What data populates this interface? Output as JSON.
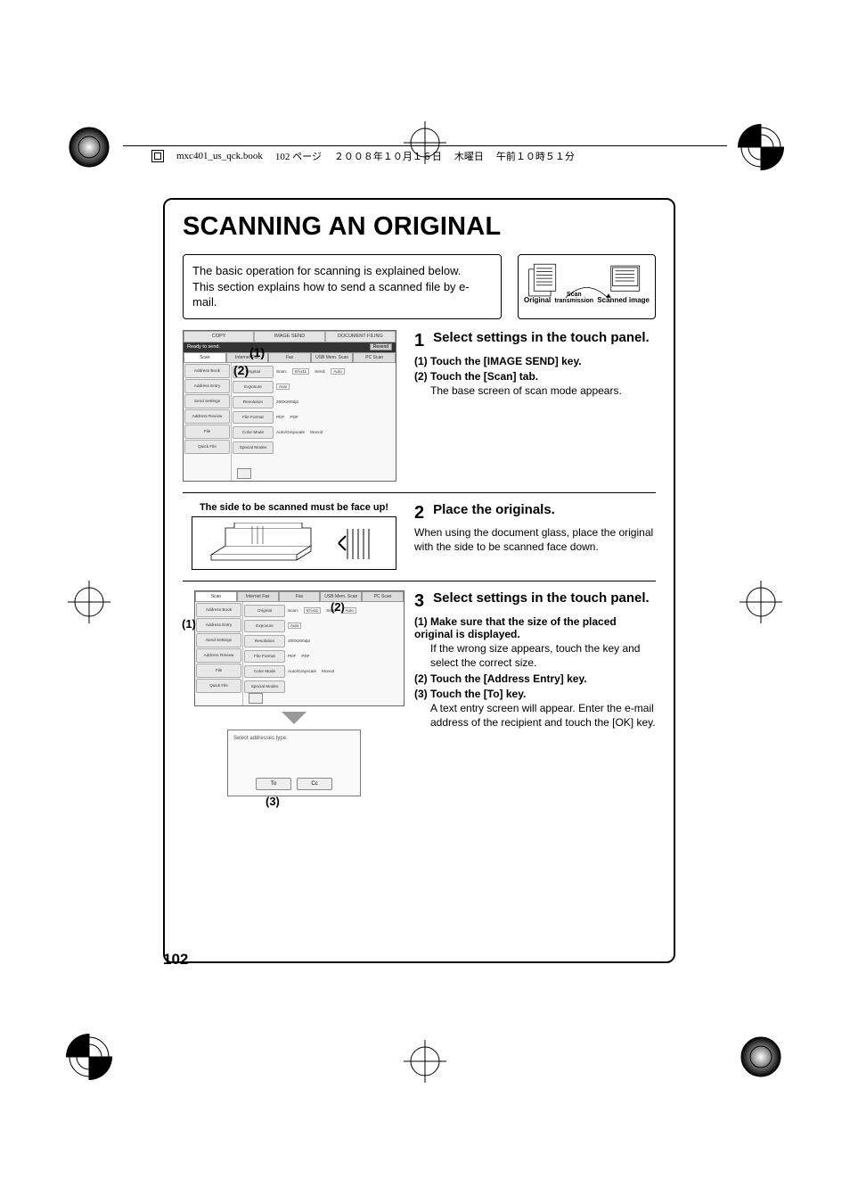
{
  "header_meta": {
    "filename": "mxc401_us_qck.book",
    "page_jp": "102 ページ",
    "date_jp": "２００８年１０月１６日",
    "weekday_jp": "木曜日",
    "time_jp": "午前１０時５１分"
  },
  "page_title": "SCANNING AN ORIGINAL",
  "intro": {
    "line1": "The basic operation for scanning is explained below.",
    "line2": "This section explains how to send a scanned file by e-mail."
  },
  "diagram_labels": {
    "left": "Original",
    "mid_top": "Scan",
    "mid_bot": "transmission",
    "right": "Scanned image"
  },
  "panel_labels": {
    "toptabs": {
      "copy": "COPY",
      "image_send": "IMAGE SEND",
      "doc_filing": "DOCUMENT FILING"
    },
    "status": "Ready to send.",
    "resend": "Resend",
    "scantabs": {
      "scan": "Scan",
      "ifax": "Internet Fax",
      "fax": "Fax",
      "usb": "USB Mem. Scan",
      "pc": "PC Scan"
    },
    "side": {
      "address_book": "Address Book",
      "address_entry": "Address Entry",
      "send_settings": "Send Settings",
      "address_review": "Address Review",
      "file": "File",
      "quick_file": "Quick File"
    },
    "rows": {
      "original": {
        "lbl": "Original",
        "scan": "Scan:",
        "scan_val": "8½x11",
        "send": "Send:",
        "send_val": "Auto"
      },
      "exposure": {
        "lbl": "Exposure",
        "val": "Auto"
      },
      "resolution": {
        "lbl": "Resolution",
        "val": "200X200dpi"
      },
      "file_format": {
        "lbl": "File Format",
        "val1": "PDF",
        "val2": "PDF"
      },
      "color_mode": {
        "lbl": "Color Mode",
        "val1": "Auto/Grayscale",
        "val2": "Mono2"
      },
      "special": {
        "lbl": "Special Modes"
      }
    }
  },
  "callouts": {
    "c1": "(1)",
    "c2": "(2)",
    "c3": "(3)"
  },
  "steps": {
    "s1": {
      "num": "1",
      "head": "Select settings in the touch panel.",
      "sub1": "(1) Touch the [IMAGE SEND] key.",
      "sub2": "(2) Touch the [Scan] tab.",
      "body2": "The base screen of scan mode appears."
    },
    "s2": {
      "num": "2",
      "head": "Place the originals.",
      "body": "When using the document glass, place the original with the side to be scanned face down.",
      "faceup": "The side to be scanned must be face up!"
    },
    "s3": {
      "num": "3",
      "head": "Select settings in the touch panel.",
      "sub1": "(1) Make sure that the size of the placed original is displayed.",
      "body1": "If the wrong size appears, touch the key and select the correct size.",
      "sub2": "(2) Touch the [Address Entry] key.",
      "sub3": "(3) Touch the [To] key.",
      "body3": "A text entry screen will appear. Enter the e-mail address of the recipient and touch the [OK] key."
    }
  },
  "popup": {
    "title": "Select addresses type.",
    "to": "To",
    "cc": "Cc"
  },
  "page_number": "102"
}
